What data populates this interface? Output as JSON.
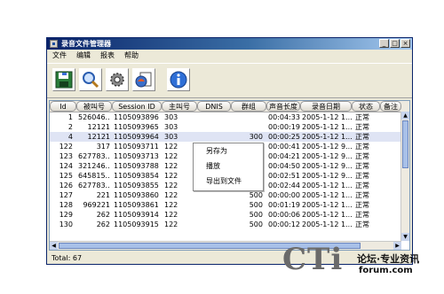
{
  "window": {
    "title": "录音文件管理器",
    "controls": [
      "_",
      "□",
      "×"
    ]
  },
  "menu": [
    "文件",
    "编辑",
    "报表",
    "帮助"
  ],
  "toolbar": {
    "buttons": [
      {
        "icon": "save-icon"
      },
      {
        "icon": "search-icon"
      },
      {
        "icon": "settings-gear-icon"
      },
      {
        "icon": "export-icon"
      },
      {
        "icon": "info-icon"
      }
    ]
  },
  "table": {
    "columns": [
      "Id",
      "被叫号",
      "Session ID",
      "主叫号",
      "DNIS",
      "群组",
      "声音长度",
      "录音日期",
      "状态",
      "备注"
    ],
    "rows": [
      {
        "id": "1",
        "called": "526046...",
        "session": "1105093896",
        "caller": "303",
        "dnis": "",
        "group": "",
        "duration": "00:04:33",
        "date": "2005-1-12 1...",
        "status": "正常"
      },
      {
        "id": "2",
        "called": "12121",
        "session": "1105093965",
        "caller": "303",
        "dnis": "",
        "group": "",
        "duration": "00:00:19",
        "date": "2005-1-12 1...",
        "status": "正常"
      },
      {
        "id": "4",
        "called": "12121",
        "session": "1105093964",
        "caller": "303",
        "dnis": "",
        "group": "300",
        "duration": "00:00:25",
        "date": "2005-1-12 1...",
        "status": "正常"
      },
      {
        "id": "122",
        "called": "317",
        "session": "1105093711",
        "caller": "122",
        "dnis": "",
        "group": "",
        "duration": "00:00:41",
        "date": "2005-1-12 9...",
        "status": "正常"
      },
      {
        "id": "123",
        "called": "627783...",
        "session": "1105093713",
        "caller": "122",
        "dnis": "",
        "group": "",
        "duration": "00:04:21",
        "date": "2005-1-12 9...",
        "status": "正常"
      },
      {
        "id": "124",
        "called": "321246...",
        "session": "1105093788",
        "caller": "122",
        "dnis": "",
        "group": "",
        "duration": "00:04:50",
        "date": "2005-1-12 9...",
        "status": "正常"
      },
      {
        "id": "125",
        "called": "645815...",
        "session": "1105093854",
        "caller": "122",
        "dnis": "",
        "group": "",
        "duration": "00:02:51",
        "date": "2005-1-12 9...",
        "status": "正常"
      },
      {
        "id": "126",
        "called": "627783...",
        "session": "1105093855",
        "caller": "122",
        "dnis": "",
        "group": "500",
        "duration": "00:02:44",
        "date": "2005-1-12 1...",
        "status": "正常"
      },
      {
        "id": "127",
        "called": "221",
        "session": "1105093860",
        "caller": "122",
        "dnis": "",
        "group": "500",
        "duration": "00:00:00",
        "date": "2005-1-12 1...",
        "status": "正常"
      },
      {
        "id": "128",
        "called": "969221",
        "session": "1105093861",
        "caller": "122",
        "dnis": "",
        "group": "500",
        "duration": "00:01:19",
        "date": "2005-1-12 1...",
        "status": "正常"
      },
      {
        "id": "129",
        "called": "262",
        "session": "1105093914",
        "caller": "122",
        "dnis": "",
        "group": "500",
        "duration": "00:00:06",
        "date": "2005-1-12 1...",
        "status": "正常"
      },
      {
        "id": "130",
        "called": "262",
        "session": "1105093915",
        "caller": "122",
        "dnis": "",
        "group": "500",
        "duration": "00:00:12",
        "date": "2005-1-12 1...",
        "status": "正常"
      }
    ]
  },
  "context_menu": [
    "另存为",
    "播放",
    "导出到文件"
  ],
  "status": "Total: 67",
  "watermark": {
    "brand": "CTi",
    "cn": "论坛·专业资讯",
    "url": "forum.com"
  }
}
